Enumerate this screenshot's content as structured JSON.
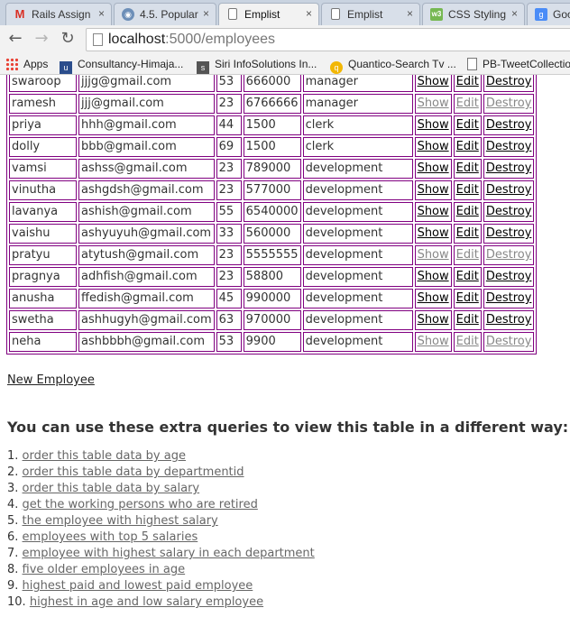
{
  "browser": {
    "tabs": [
      {
        "icon": "gmail-icon",
        "title": "Rails Assign",
        "close": "×"
      },
      {
        "icon": "stackoverflow-icon",
        "title": "4.5. Popular",
        "close": "×"
      },
      {
        "icon": "page-icon",
        "title": "Emplist",
        "close": "×"
      },
      {
        "icon": "page-icon",
        "title": "Emplist",
        "close": "×"
      },
      {
        "icon": "w3schools-icon",
        "title": "CSS Styling",
        "close": "×"
      },
      {
        "icon": "google-icon",
        "title": "Goog",
        "close": ""
      }
    ],
    "url_host": "localhost",
    "url_path": ":5000/employees",
    "bookmarks": [
      {
        "icon": "apps-icon",
        "label": "Apps"
      },
      {
        "icon": "ustr-icon",
        "label": "Consultancy-Himaja..."
      },
      {
        "icon": "siri-icon",
        "label": "Siri InfoSolutions In..."
      },
      {
        "icon": "quantico-icon",
        "label": "Quantico-Search Tv ..."
      },
      {
        "icon": "page-icon",
        "label": "PB-TweetCollectio"
      }
    ]
  },
  "employees": [
    {
      "name": "swaroop",
      "email": "jjjg@gmail.com",
      "age": "53",
      "salary": "666000",
      "dept": "manager",
      "show": "Show",
      "edit": "Edit",
      "destroy": "Destroy"
    },
    {
      "name": "ramesh",
      "email": "jjj@gmail.com",
      "age": "23",
      "salary": "6766666",
      "dept": "manager",
      "show": "Show",
      "edit": "Edit",
      "destroy": "Destroy"
    },
    {
      "name": "priya",
      "email": "hhh@gmail.com",
      "age": "44",
      "salary": "1500",
      "dept": "clerk",
      "show": "Show",
      "edit": "Edit",
      "destroy": "Destroy"
    },
    {
      "name": "dolly",
      "email": "bbb@gmail.com",
      "age": "69",
      "salary": "1500",
      "dept": "clerk",
      "show": "Show",
      "edit": "Edit",
      "destroy": "Destroy"
    },
    {
      "name": "vamsi",
      "email": "ashss@gmail.com",
      "age": "23",
      "salary": "789000",
      "dept": "development",
      "show": "Show",
      "edit": "Edit",
      "destroy": "Destroy"
    },
    {
      "name": "vinutha",
      "email": "ashgdsh@gmail.com",
      "age": "23",
      "salary": "577000",
      "dept": "development",
      "show": "Show",
      "edit": "Edit",
      "destroy": "Destroy"
    },
    {
      "name": "lavanya",
      "email": "ashish@gmail.com",
      "age": "55",
      "salary": "6540000",
      "dept": "development",
      "show": "Show",
      "edit": "Edit",
      "destroy": "Destroy"
    },
    {
      "name": "vaishu",
      "email": "ashyuyuh@gmail.com",
      "age": "33",
      "salary": "560000",
      "dept": "development",
      "show": "Show",
      "edit": "Edit",
      "destroy": "Destroy"
    },
    {
      "name": "pratyu",
      "email": "atytush@gmail.com",
      "age": "23",
      "salary": "5555555",
      "dept": "development",
      "show": "Show",
      "edit": "Edit",
      "destroy": "Destroy"
    },
    {
      "name": "pragnya",
      "email": "adhfish@gmail.com",
      "age": "23",
      "salary": "58800",
      "dept": "development",
      "show": "Show",
      "edit": "Edit",
      "destroy": "Destroy"
    },
    {
      "name": "anusha",
      "email": "ffedish@gmail.com",
      "age": "45",
      "salary": "990000",
      "dept": "development",
      "show": "Show",
      "edit": "Edit",
      "destroy": "Destroy"
    },
    {
      "name": "swetha",
      "email": "ashhugyh@gmail.com",
      "age": "63",
      "salary": "970000",
      "dept": "development",
      "show": "Show",
      "edit": "Edit",
      "destroy": "Destroy"
    },
    {
      "name": "neha",
      "email": "ashbbbh@gmail.com",
      "age": "53",
      "salary": "9900",
      "dept": "development",
      "show": "Show",
      "edit": "Edit",
      "destroy": "Destroy"
    }
  ],
  "new_employee_label": "New Employee",
  "queries_title": "You can use these extra queries to view this table in a different way:",
  "queries": [
    {
      "num": "1.",
      "label": "order this table data by age"
    },
    {
      "num": "2.",
      "label": "order this table data by departmentid"
    },
    {
      "num": "3.",
      "label": "order this table data by salary"
    },
    {
      "num": "4.",
      "label": "get the working persons who are retired"
    },
    {
      "num": "5.",
      "label": "the employee with highest salary"
    },
    {
      "num": "6.",
      "label": "employees with top 5 salaries"
    },
    {
      "num": "7.",
      "label": "employee with highest salary in each department"
    },
    {
      "num": "8.",
      "label": "five older employees in age"
    },
    {
      "num": "9.",
      "label": "highest paid and lowest paid employee"
    },
    {
      "num": "10.",
      "label": "highest in age and low salary employee"
    }
  ]
}
